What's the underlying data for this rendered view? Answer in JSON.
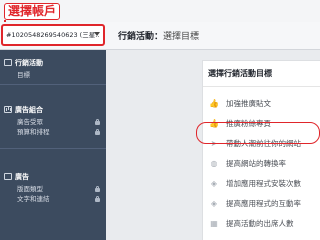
{
  "annotation": {
    "title": "選擇帳戶"
  },
  "header": {
    "account_selector": "#1020548269540623 (三星...",
    "breadcrumb_section": "行銷活動：",
    "breadcrumb_page": "選擇目標"
  },
  "sidebar": {
    "sections": [
      {
        "title": "行銷活動",
        "icon": "folder-icon",
        "items": [
          {
            "label": "目標",
            "locked": false
          }
        ]
      },
      {
        "title": "廣告組合",
        "icon": "adset-icon",
        "items": [
          {
            "label": "廣告受眾",
            "locked": true
          },
          {
            "label": "預算和排程",
            "locked": true
          }
        ]
      },
      {
        "title": "廣告",
        "icon": "ad-icon",
        "items": [
          {
            "label": "版面類型",
            "locked": true
          },
          {
            "label": "文字和連結",
            "locked": true
          }
        ]
      }
    ]
  },
  "objectives_card": {
    "title": "選擇行銷活動目標",
    "items": [
      {
        "label": "加強推廣貼文",
        "icon": "thumbs-up-icon"
      },
      {
        "label": "推廣粉絲專頁",
        "icon": "thumbs-up-icon"
      },
      {
        "label": "帶動人潮前往你的網站",
        "icon": "cursor-icon",
        "highlighted": true
      },
      {
        "label": "提高網站的轉換率",
        "icon": "globe-icon"
      },
      {
        "label": "增加應用程式安裝次數",
        "icon": "cube-icon"
      },
      {
        "label": "提高應用程式的互動率",
        "icon": "cube-icon"
      },
      {
        "label": "提高活動的出席人數",
        "icon": "calendar-icon"
      }
    ]
  },
  "colors": {
    "highlight": "#e0262b",
    "sidebar_bg": "#3c4b5f"
  }
}
